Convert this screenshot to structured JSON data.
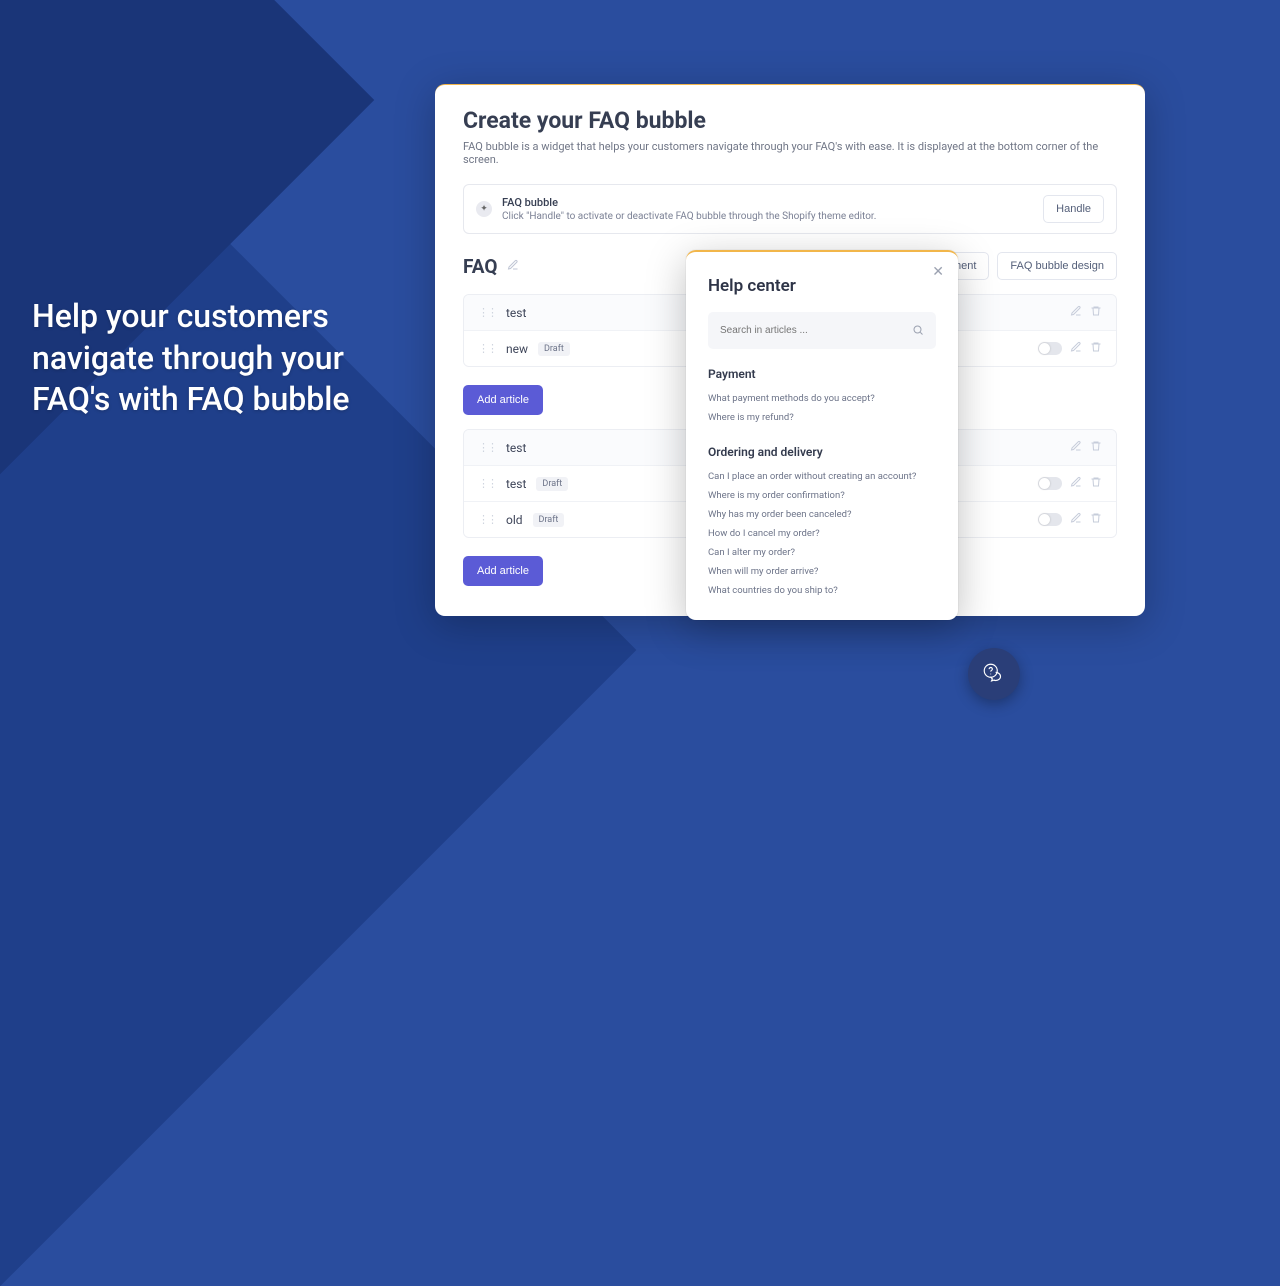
{
  "tagline": "Help your customers navigate through your FAQ's with FAQ bubble",
  "panel": {
    "title": "Create your FAQ bubble",
    "desc": "FAQ bubble is a widget that helps your customers navigate through your FAQ's with ease. It is displayed at the bottom corner of the screen.",
    "banner": {
      "title": "FAQ bubble",
      "subtitle": "Click \"Handle\" to activate or deactivate FAQ bubble through the Shopify theme editor.",
      "button": "Handle"
    },
    "section_title": "FAQ",
    "placement_btn": "FAQ bubble placement",
    "design_btn": "FAQ bubble design",
    "badge_draft": "Draft",
    "add_article": "Add article",
    "groups": [
      {
        "header": "test",
        "rows": [
          {
            "title": "new",
            "draft": true
          }
        ]
      },
      {
        "header": "test",
        "rows": [
          {
            "title": "test",
            "draft": true
          },
          {
            "title": "old",
            "draft": true
          }
        ]
      }
    ]
  },
  "help": {
    "title": "Help center",
    "search_placeholder": "Search in articles ...",
    "categories": [
      {
        "title": "Payment",
        "questions": [
          "What payment methods do you accept?",
          "Where is my refund?"
        ]
      },
      {
        "title": "Ordering and delivery",
        "questions": [
          "Can I place an order without creating an account?",
          "Where is my order confirmation?",
          "Why has my order been canceled?",
          "How do I cancel my order?",
          "Can I alter my order?",
          "When will my order arrive?",
          "What countries do you ship to?"
        ]
      }
    ]
  }
}
